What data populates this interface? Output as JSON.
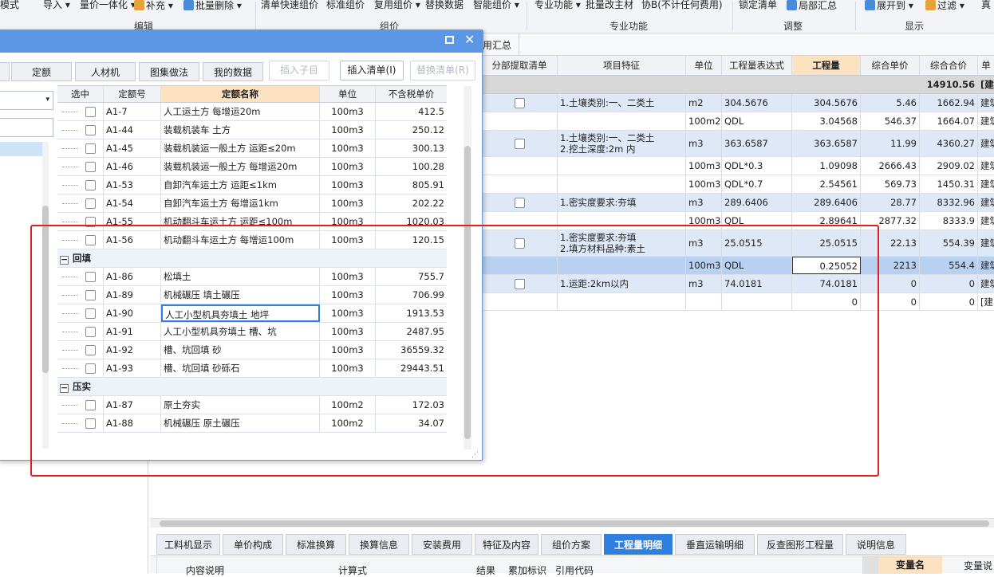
{
  "ribbon": {
    "buttons": [
      "模式",
      "导入",
      "量价一体化",
      "补充",
      "批量删除",
      "清单快速组价",
      "标准组价",
      "复用组价",
      "替换数据",
      "智能组价",
      "专业功能",
      "批量改主材",
      "协B(不计任何费用)",
      "锁定清单",
      "局部汇总",
      "展开到",
      "过滤",
      "真"
    ],
    "groups": [
      "编辑",
      "组价",
      "专业功能",
      "调整",
      "显示"
    ]
  },
  "doc_tab": "用汇总",
  "main": {
    "headers": [
      "分部提取清单",
      "项目特征",
      "单位",
      "工程量表达式",
      "工程量",
      "综合单价",
      "综合合价",
      "单"
    ],
    "total_row": {
      "price": "14910.56",
      "tag": "[建"
    },
    "rows": [
      {
        "type": "blue",
        "chk": true,
        "feature": "1.土壤类别:一、二类土",
        "unit": "m2",
        "expr": "304.5676",
        "qty": "304.5676",
        "unit_price": "5.46",
        "total": "1662.94",
        "tag": "建筑"
      },
      {
        "type": "white",
        "chk": false,
        "feature": "",
        "unit": "100m2",
        "expr": "QDL",
        "qty": "3.04568",
        "unit_price": "546.37",
        "total": "1664.07",
        "tag": "建筑"
      },
      {
        "type": "blue",
        "chk": true,
        "feature": "1.土壤类别:一、二类土",
        "feature2": "2.挖土深度:2m 内",
        "unit": "m3",
        "expr": "363.6587",
        "qty": "363.6587",
        "unit_price": "11.99",
        "total": "4360.27",
        "tag": "建筑"
      },
      {
        "type": "white",
        "chk": false,
        "feature": "",
        "unit": "100m3",
        "expr": "QDL*0.3",
        "qty": "1.09098",
        "unit_price": "2666.43",
        "total": "2909.02",
        "tag": "建筑"
      },
      {
        "type": "white",
        "chk": false,
        "feature": "",
        "unit": "100m3",
        "expr": "QDL*0.7",
        "qty": "2.54561",
        "unit_price": "569.73",
        "total": "1450.31",
        "tag": "建筑"
      },
      {
        "type": "blue",
        "chk": true,
        "feature": "1.密实度要求:夯填",
        "unit": "m3",
        "expr": "289.6406",
        "qty": "289.6406",
        "unit_price": "28.77",
        "total": "8332.96",
        "tag": "建筑"
      },
      {
        "type": "white",
        "chk": false,
        "feature": "",
        "unit": "100m3",
        "expr": "QDL",
        "qty": "2.89641",
        "unit_price": "2877.32",
        "total": "8333.9",
        "tag": "建筑"
      },
      {
        "type": "blue",
        "chk": true,
        "feature": "1.密实度要求:夯填",
        "feature2": "2.填方材料品种:素土",
        "unit": "m3",
        "expr": "25.0515",
        "qty": "25.0515",
        "unit_price": "22.13",
        "total": "554.39",
        "tag": "建筑"
      },
      {
        "type": "sel",
        "chk": false,
        "feature": "",
        "unit": "100m3",
        "expr": "QDL",
        "qty": "0.25052",
        "unit_price": "2213",
        "total": "554.4",
        "tag": "建筑"
      },
      {
        "type": "blue",
        "chk": true,
        "feature": "1.运距:2km以内",
        "unit": "m3",
        "expr": "74.0181",
        "qty": "74.0181",
        "unit_price": "0",
        "total": "0",
        "tag": "建筑"
      },
      {
        "type": "white",
        "chk": false,
        "feature": "",
        "unit": "",
        "expr": "",
        "qty": "0",
        "unit_price": "0",
        "total": "0",
        "tag": "[建"
      }
    ]
  },
  "dialog": {
    "tabs": [
      "定额",
      "人材机",
      "图集做法",
      "我的数据"
    ],
    "buttons": [
      "插入子目",
      "插入清单(I)",
      "替换清单(R)"
    ],
    "headers": [
      "选中",
      "定额号",
      "定额名称",
      "单位",
      "不含税单价"
    ],
    "rows": [
      {
        "kind": "item",
        "code": "A1-7",
        "name": "人工运土方 每增运20m",
        "unit": "100m3",
        "price": "412.5"
      },
      {
        "kind": "item",
        "code": "A1-44",
        "name": "装载机装车 土方",
        "unit": "100m3",
        "price": "250.12"
      },
      {
        "kind": "item",
        "code": "A1-45",
        "name": "装载机装运一般土方 运距≤20m",
        "unit": "100m3",
        "price": "300.13"
      },
      {
        "kind": "item",
        "code": "A1-46",
        "name": "装载机装运一般土方 每增运20m",
        "unit": "100m3",
        "price": "100.28"
      },
      {
        "kind": "item",
        "code": "A1-53",
        "name": "自卸汽车运土方 运距≤1km",
        "unit": "100m3",
        "price": "805.91"
      },
      {
        "kind": "item",
        "code": "A1-54",
        "name": "自卸汽车运土方 每增运1km",
        "unit": "100m3",
        "price": "202.22"
      },
      {
        "kind": "item",
        "code": "A1-55",
        "name": "机动翻斗车运土方 运距≤100m",
        "unit": "100m3",
        "price": "1020.03"
      },
      {
        "kind": "item",
        "code": "A1-56",
        "name": "机动翻斗车运土方 每增运100m",
        "unit": "100m3",
        "price": "120.15"
      },
      {
        "kind": "group",
        "name": "回填"
      },
      {
        "kind": "item",
        "code": "A1-86",
        "name": "松填土",
        "unit": "100m3",
        "price": "755.7"
      },
      {
        "kind": "item",
        "code": "A1-89",
        "name": "机械碾压 填土碾压",
        "unit": "100m3",
        "price": "706.99"
      },
      {
        "kind": "item",
        "code": "A1-90",
        "name": "人工小型机具夯填土 地坪",
        "unit": "100m3",
        "price": "1913.53",
        "focus": true
      },
      {
        "kind": "item",
        "code": "A1-91",
        "name": "人工小型机具夯填土 槽、坑",
        "unit": "100m3",
        "price": "2487.95"
      },
      {
        "kind": "item",
        "code": "A1-92",
        "name": "槽、坑回填 砂",
        "unit": "100m3",
        "price": "36559.32"
      },
      {
        "kind": "item",
        "code": "A1-93",
        "name": "槽、坑回填 砂砾石",
        "unit": "100m3",
        "price": "29443.51"
      },
      {
        "kind": "group",
        "name": "压实"
      },
      {
        "kind": "item",
        "code": "A1-87",
        "name": "原土夯实",
        "unit": "100m2",
        "price": "172.03"
      },
      {
        "kind": "item",
        "code": "A1-88",
        "name": "机械碾压 原土碾压",
        "unit": "100m2",
        "price": "34.07"
      }
    ]
  },
  "bottom": {
    "tabs": [
      "工料机显示",
      "单价构成",
      "标准换算",
      "换算信息",
      "安装费用",
      "特征及内容",
      "组价方案",
      "工程量明细",
      "垂直运输明细",
      "反查图形工程量",
      "说明信息"
    ],
    "active_tab": "工程量明细",
    "sub_headers": [
      "内容说明",
      "计算式",
      "结果",
      "累加标识",
      "引用代码"
    ],
    "right_headers": [
      "变量名",
      "变量说"
    ]
  },
  "colors": {
    "accent": "#2f7fe0",
    "highlight_box": "#e02020",
    "dialog_title": "#5b97e5"
  }
}
